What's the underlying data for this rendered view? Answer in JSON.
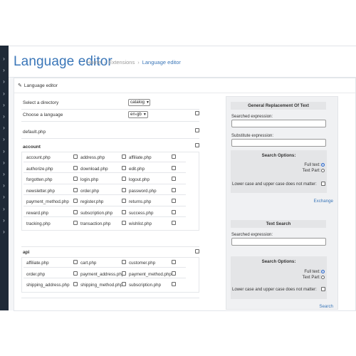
{
  "header": {
    "title": "Language editor",
    "breadcrumbs": [
      "Home",
      "Extensions",
      "Language editor"
    ]
  },
  "card": {
    "title": "Language editor"
  },
  "form": {
    "directory_label": "Select a directory",
    "directory_value": "catalog",
    "language_label": "Choose a language",
    "language_value": "en-gb",
    "default_file": "default.php"
  },
  "groups": [
    {
      "name": "account",
      "files": [
        [
          "account.php",
          "address.php",
          "affiliate.php"
        ],
        [
          "authorize.php",
          "download.php",
          "edit.php"
        ],
        [
          "forgotten.php",
          "login.php",
          "logout.php"
        ],
        [
          "newsletter.php",
          "order.php",
          "password.php"
        ],
        [
          "payment_method.php",
          "register.php",
          "returns.php"
        ],
        [
          "reward.php",
          "subscription.php",
          "success.php"
        ],
        [
          "tracking.php",
          "transaction.php",
          "wishlist.php"
        ]
      ]
    },
    {
      "name": "api",
      "files": [
        [
          "affiliate.php",
          "cart.php",
          "customer.php"
        ],
        [
          "order.php",
          "payment_address.php",
          "payment_method.php"
        ],
        [
          "shipping_address.php",
          "shipping_method.php",
          "subscription.php"
        ]
      ]
    }
  ],
  "replace_panel": {
    "title": "General Replacement Of Text",
    "searched_label": "Searched expression:",
    "substitute_label": "Substitute expression:",
    "options_title": "Search Options:",
    "full_text": "Full text:",
    "text_part": "Text Part:",
    "case_label": "Lower case and upper case does not matter:",
    "action": "Exchange"
  },
  "search_panel": {
    "title": "Text Search",
    "searched_label": "Searched expression:",
    "options_title": "Search Options:",
    "full_text": "Full text:",
    "text_part": "Text Part:",
    "case_label": "Lower case and upper case does not matter:",
    "action": "Search"
  },
  "icons": {
    "edit": "pencil-icon",
    "sidebar_expand": "chevron-right-icon"
  },
  "colors": {
    "accent": "#3a76b8",
    "sidebar": "#1f2a37"
  }
}
